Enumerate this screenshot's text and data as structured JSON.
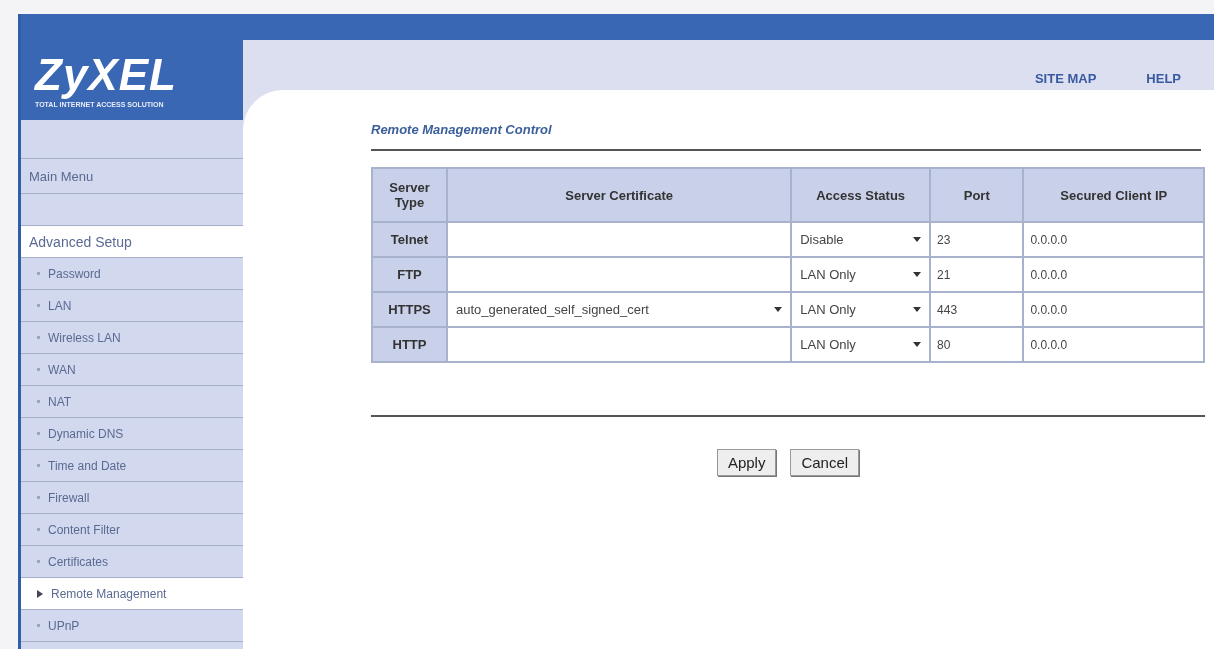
{
  "logo": {
    "name": "ZyXEL",
    "tagline": "TOTAL INTERNET ACCESS SOLUTION"
  },
  "top_links": [
    "SITE MAP",
    "HELP"
  ],
  "sidebar": {
    "main_menu": "Main Menu",
    "section": "Advanced Setup",
    "items": [
      {
        "label": "Password",
        "selected": false
      },
      {
        "label": "LAN",
        "selected": false
      },
      {
        "label": "Wireless LAN",
        "selected": false
      },
      {
        "label": "WAN",
        "selected": false
      },
      {
        "label": "NAT",
        "selected": false
      },
      {
        "label": "Dynamic DNS",
        "selected": false
      },
      {
        "label": "Time and Date",
        "selected": false
      },
      {
        "label": "Firewall",
        "selected": false
      },
      {
        "label": "Content Filter",
        "selected": false
      },
      {
        "label": "Certificates",
        "selected": false
      },
      {
        "label": "Remote Management",
        "selected": true
      },
      {
        "label": "UPnP",
        "selected": false
      }
    ]
  },
  "section_title": "Remote Management Control",
  "table": {
    "columns": [
      "Server Type",
      "Server Certificate",
      "Access Status",
      "Port",
      "Secured Client IP"
    ],
    "rows": [
      {
        "server_type": "Telnet",
        "access_status": "Disable",
        "port": "23",
        "client_ip": "0.0.0.0"
      },
      {
        "server_type": "FTP",
        "access_status": "LAN Only",
        "port": "21",
        "client_ip": "0.0.0.0"
      },
      {
        "server_type": "HTTPS",
        "certificate": "auto_generated_self_signed_cert",
        "access_status": "LAN Only",
        "port": "443",
        "client_ip": "0.0.0.0"
      },
      {
        "server_type": "HTTP",
        "access_status": "LAN Only",
        "port": "80",
        "client_ip": "0.0.0.0"
      }
    ]
  },
  "buttons": [
    "Apply",
    "Cancel"
  ]
}
